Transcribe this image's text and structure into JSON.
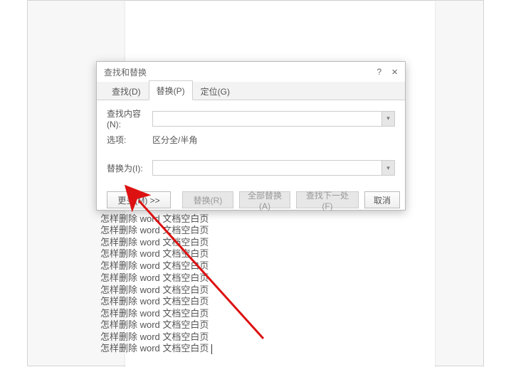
{
  "doc_line_text": "怎样删除 word  文档空白页",
  "doc_line_tops": [
    88,
    300,
    316,
    333,
    349,
    366,
    383,
    400,
    416,
    433,
    449,
    466,
    482
  ],
  "dialog": {
    "title": "查找和替换",
    "help": "?",
    "close": "×",
    "tabs": {
      "find": "查找(D)",
      "replace": "替换(P)",
      "goto": "定位(G)"
    },
    "find_label": "查找内容(N):",
    "options_label": "选项:",
    "options_value": "区分全/半角",
    "replace_label": "替换为(I):",
    "find_value": "",
    "replace_value": "",
    "buttons": {
      "more": "更多(M) >>",
      "replace": "替换(R)",
      "replace_all": "全部替换(A)",
      "find_next": "查找下一处(F)",
      "cancel": "取消"
    }
  }
}
